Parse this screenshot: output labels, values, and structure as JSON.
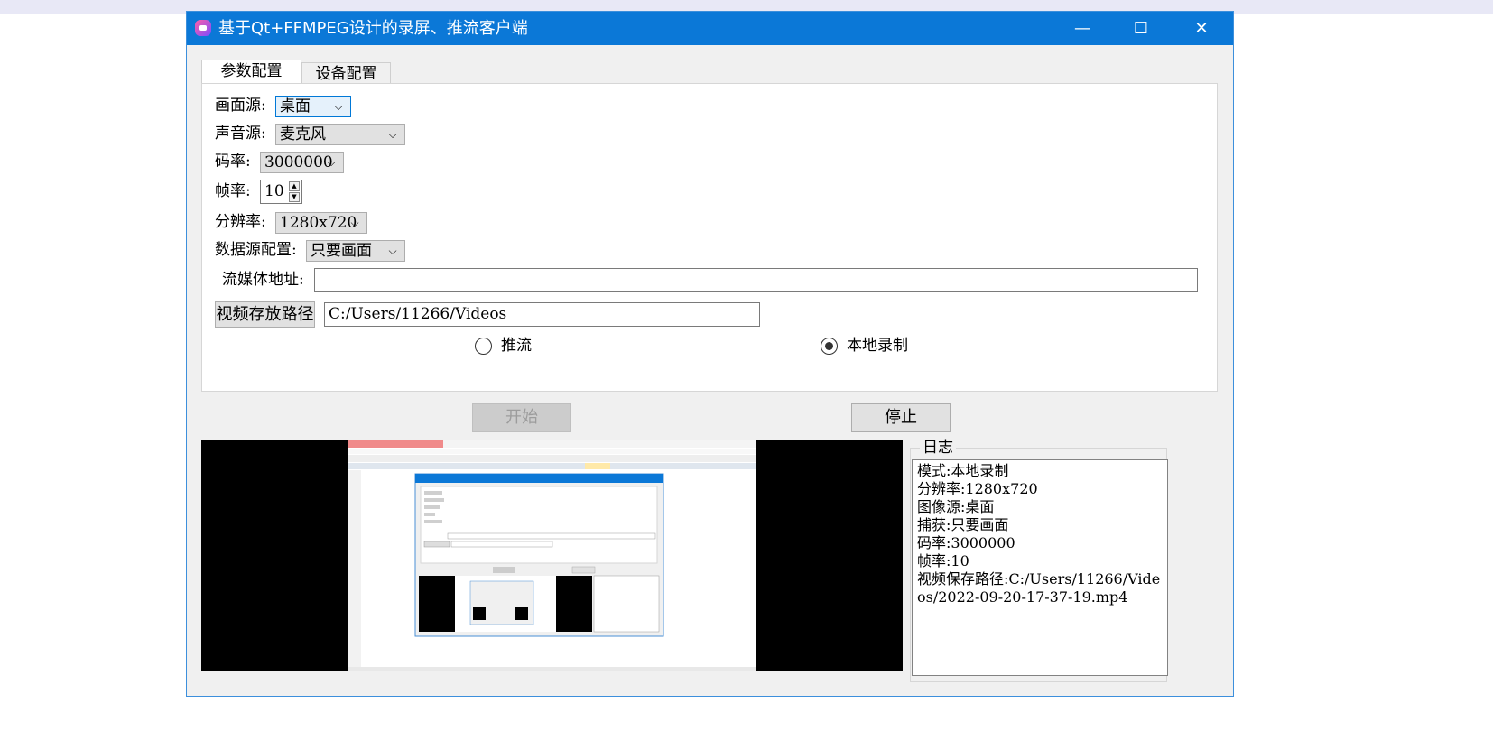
{
  "window": {
    "title": "基于Qt+FFMPEG设计的录屏、推流客户端",
    "buttons": {
      "minimize": "—",
      "maximize": "☐",
      "close": "✕"
    }
  },
  "tabs": [
    "参数配置",
    "设备配置"
  ],
  "form": {
    "video_source_label": "画面源:",
    "video_source_value": "桌面",
    "audio_source_label": "声音源:",
    "audio_source_value": "麦克风",
    "bitrate_label": "码率:",
    "bitrate_value": "3000000",
    "fps_label": "帧率:",
    "fps_value": "10",
    "resolution_label": "分辨率:",
    "resolution_value": "1280x720",
    "data_source_label": "数据源配置:",
    "data_source_value": "只要画面",
    "stream_url_label": "流媒体地址:",
    "stream_url_value": "",
    "save_path_button": "视频存放路径",
    "save_path_value": "C:/Users/11266/Videos",
    "radio_push_label": "推流",
    "radio_local_label": "本地录制"
  },
  "controls": {
    "start_label": "开始",
    "stop_label": "停止"
  },
  "log": {
    "title": "日志",
    "text": "模式:本地录制\n分辨率:1280x720\n图像源:桌面\n捕获:只要画面\n码率:3000000\n帧率:10\n视频保存路径:C:/Users/11266/Videos/2022-09-20-17-37-19.mp4"
  },
  "colors": {
    "titlebar": "#0b78d7",
    "window_bg": "#f0f0f0",
    "focus_border": "#0078d7"
  }
}
